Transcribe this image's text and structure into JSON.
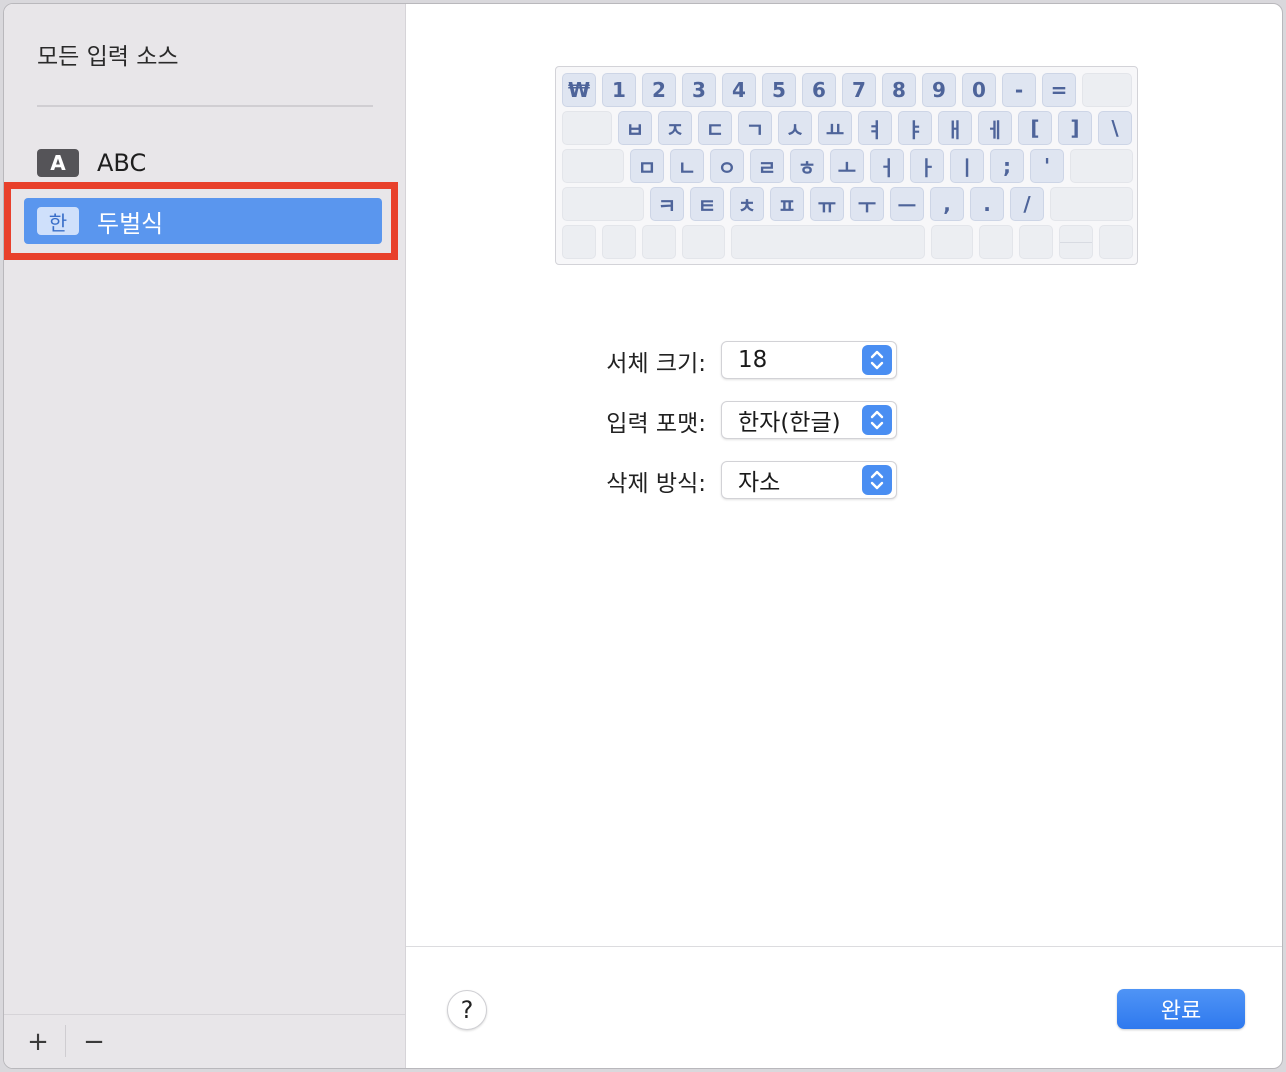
{
  "sidebar": {
    "title": "모든 입력 소스",
    "items": [
      {
        "badge": "A",
        "label": "ABC"
      },
      {
        "badge": "한",
        "label": "두벌식"
      }
    ],
    "add_label": "+",
    "remove_label": "−"
  },
  "keyboard": {
    "row1": [
      "₩",
      "1",
      "2",
      "3",
      "4",
      "5",
      "6",
      "7",
      "8",
      "9",
      "0",
      "-",
      "="
    ],
    "row2": [
      "ㅂ",
      "ㅈ",
      "ㄷ",
      "ㄱ",
      "ㅅ",
      "ㅛ",
      "ㅕ",
      "ㅑ",
      "ㅐ",
      "ㅔ",
      "[",
      "]",
      "\\"
    ],
    "row3": [
      "ㅁ",
      "ㄴ",
      "ㅇ",
      "ㄹ",
      "ㅎ",
      "ㅗ",
      "ㅓ",
      "ㅏ",
      "ㅣ",
      ";",
      "'"
    ],
    "row4": [
      "ㅋ",
      "ㅌ",
      "ㅊ",
      "ㅍ",
      "ㅠ",
      "ㅜ",
      "ㅡ",
      ",",
      ".",
      "/"
    ]
  },
  "settings": {
    "font_size_label": "서체 크기:",
    "font_size_value": "18",
    "input_format_label": "입력 포맷:",
    "input_format_value": "한자(한글)",
    "delete_mode_label": "삭제 방식:",
    "delete_mode_value": "자소"
  },
  "footer": {
    "help_label": "?",
    "done_label": "완료"
  },
  "colors": {
    "accent": "#4a8ef2",
    "selection": "#5a96ee",
    "highlight_border": "#e8402b"
  }
}
